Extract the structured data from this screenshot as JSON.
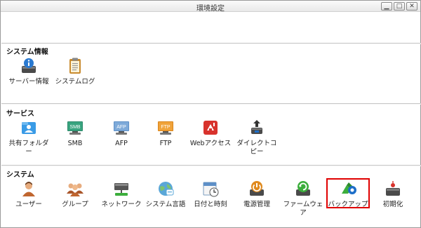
{
  "window": {
    "title": "環境設定"
  },
  "titlebar_buttons": {
    "minimize": "▁",
    "maximize": "□",
    "close": "✕"
  },
  "sections": {
    "system_info": {
      "title": "システム情報",
      "items": [
        {
          "label": "サーバー情報",
          "icon": "server-info-icon"
        },
        {
          "label": "システムログ",
          "icon": "system-log-icon"
        }
      ]
    },
    "services": {
      "title": "サービス",
      "items": [
        {
          "label": "共有フォルダー",
          "icon": "shared-folder-icon"
        },
        {
          "label": "SMB",
          "icon": "smb-icon",
          "badge": "SMB"
        },
        {
          "label": "AFP",
          "icon": "afp-icon",
          "badge": "AFP"
        },
        {
          "label": "FTP",
          "icon": "ftp-icon",
          "badge": "FTP"
        },
        {
          "label": "Webアクセス",
          "icon": "web-access-icon"
        },
        {
          "label": "ダイレクトコピー",
          "icon": "direct-copy-icon"
        }
      ]
    },
    "system": {
      "title": "システム",
      "items": [
        {
          "label": "ユーザー",
          "icon": "user-icon"
        },
        {
          "label": "グループ",
          "icon": "group-icon"
        },
        {
          "label": "ネットワーク",
          "icon": "network-icon"
        },
        {
          "label": "システム言語",
          "icon": "language-icon"
        },
        {
          "label": "日付と時刻",
          "icon": "date-time-icon"
        },
        {
          "label": "電源管理",
          "icon": "power-icon"
        },
        {
          "label": "ファームウェア",
          "icon": "firmware-icon"
        },
        {
          "label": "バックアップ",
          "icon": "backup-icon"
        },
        {
          "label": "初期化",
          "icon": "initialize-icon"
        }
      ]
    }
  },
  "colors": {
    "highlight": "#e00000"
  }
}
